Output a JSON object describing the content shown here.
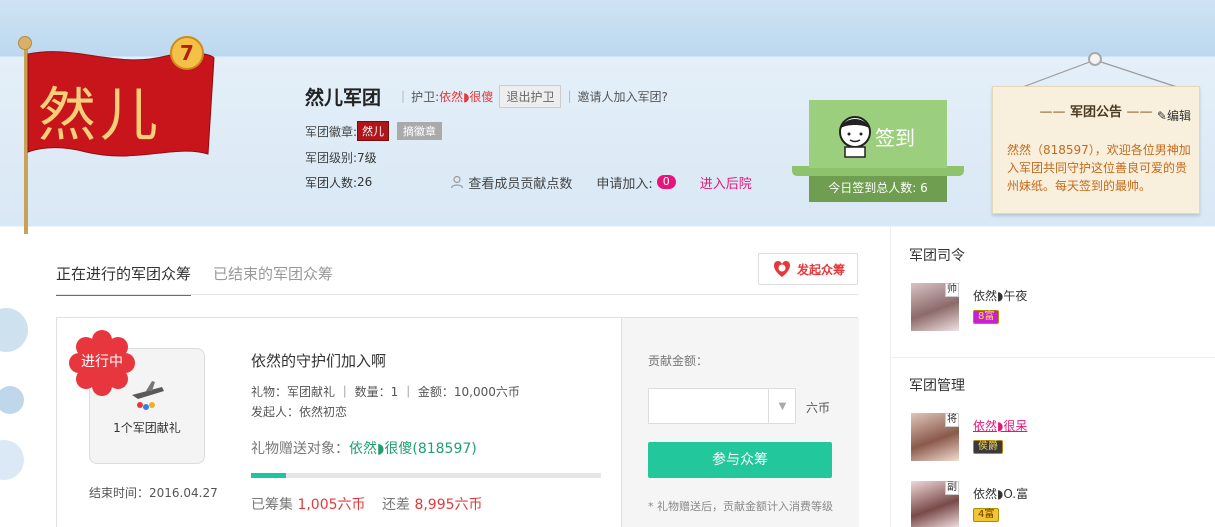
{
  "group": {
    "flag_text": "然儿",
    "flag_level": "7",
    "name": "然儿军团",
    "guard_label": "护卫:",
    "guard_name": "依然◗很傻",
    "exit_guard": "退出护卫",
    "invite": "邀请人加入军团?",
    "badge_label": "军团徽章:",
    "badge_name": "然儿",
    "badge_btn": "摘徽章",
    "level_label": "军团级别:",
    "level_value": "7级",
    "count_label": "军团人数:",
    "count_value": "26",
    "view_stats": "查看成员贡献点数",
    "apply_label": "申请加入:",
    "apply_count": "0",
    "backyard": "进入后院"
  },
  "checkin": {
    "label": "签到",
    "today_label": "今日签到总人数:",
    "today_count": "6"
  },
  "notice": {
    "title": "军团公告",
    "edit": "编辑",
    "body": "然然（818597），欢迎各位男神加入军团共同守护这位善良可爱的贵州妹纸。每天签到的最帅。"
  },
  "tabs": [
    {
      "label": "正在进行的军团众筹",
      "active": true
    },
    {
      "label": "已结束的军团众筹",
      "active": false
    }
  ],
  "launch_button": "发起众筹",
  "project": {
    "status": "进行中",
    "gift_caption": "1个军团献礼",
    "end_time": "结束时间：2016.04.27",
    "title": "依然的守护们加入啊",
    "meta_gift": "礼物：军团献礼 ｜ 数量：1 ｜ 金额：10,000六币",
    "meta_initiator": "发起人：依然初恋",
    "target_label": "礼物赠送对象：",
    "target_value": "依然◗很傻(818597)",
    "progress": 0.1005,
    "raised_label": "已筹集",
    "raised_value": "1,005六币",
    "remain_label": "还差",
    "remain_value": "8,995六币"
  },
  "contribute": {
    "label": "贡献金额：",
    "value": "",
    "unit": "六币",
    "join_button": "参与众筹",
    "note": "* 礼物赠送后，贡献金额计入消费等级"
  },
  "sidebar": {
    "commander_title": "军团司令",
    "commander": {
      "role": "帅",
      "name": "依然◗午夜",
      "level": "8富"
    },
    "management_title": "军团管理",
    "managers": [
      {
        "role": "将",
        "name": "依然◗很呆",
        "level": "侯爵",
        "highlight": true
      },
      {
        "role": "副",
        "name": "依然◗O.富",
        "level": "4富",
        "highlight": false
      }
    ]
  },
  "colors": {
    "accent_red": "#e4393c",
    "pink": "#e5157a",
    "green_button": "#22c89c",
    "checkin_green": "#9ccf7d",
    "flag_red": "#c8151b"
  }
}
